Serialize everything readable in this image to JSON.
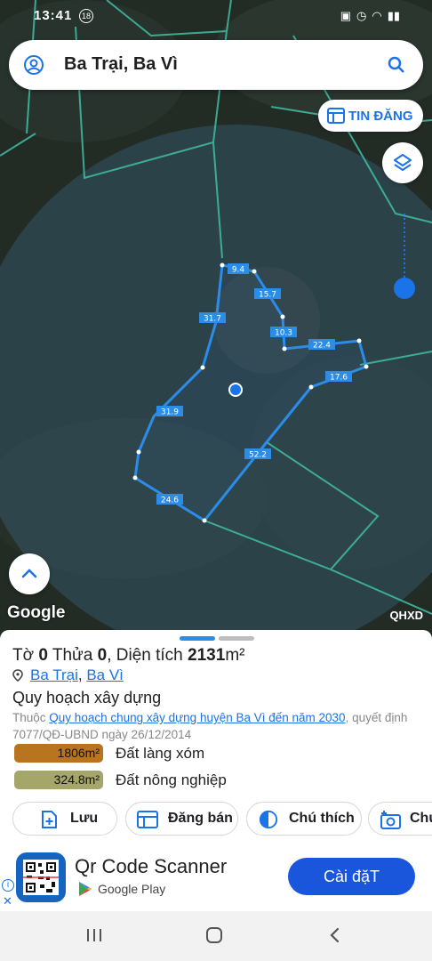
{
  "status_bar": {
    "time": "13:41",
    "notification_count": "18"
  },
  "search": {
    "query": "Ba Trại, Ba Vì"
  },
  "buttons": {
    "tin_dang": "TIN ĐĂNG"
  },
  "map": {
    "attribution": "Google",
    "layer_code": "QHXD",
    "segment_labels": [
      "9.4",
      "15.7",
      "10.3",
      "22.4",
      "17.6",
      "52.2",
      "24.6",
      "31.9",
      "31.7"
    ]
  },
  "parcel": {
    "to_label": "Tờ",
    "to_value": "0",
    "thua_label": "Thửa",
    "thua_value": "0",
    "dien_tich_label": "Diện tích",
    "dien_tich_value": "2131",
    "unit": "m²",
    "location_commune": "Ba Trại",
    "location_district": "Ba Vì",
    "location_separator": ", "
  },
  "plan": {
    "heading": "Quy hoạch xây dựng",
    "prefix": "Thuộc",
    "link": "Quy hoạch chung xây dựng huyện Ba Vì đến năm 2030",
    "decision": ", quyết định 7077/QĐ-UBND ngày 26/12/2014"
  },
  "land_uses": [
    {
      "area": "1806m²",
      "name": "Đất làng xóm",
      "color": "#b8741e"
    },
    {
      "area": "324.8m²",
      "name": "Đất nông nghiệp",
      "color": "#a4a66a"
    }
  ],
  "actions": {
    "luu": "Lưu",
    "dang_ban": "Đăng bán",
    "chu_thich": "Chú thích",
    "chup": "Chụ"
  },
  "ad": {
    "app_name": "Qr Code Scanner",
    "store": "Google Play",
    "install": "Cài đặT"
  },
  "colors": {
    "accent": "#1a73e8",
    "boundary": "#3fb8a0",
    "parcel_line": "#2b8de8"
  }
}
